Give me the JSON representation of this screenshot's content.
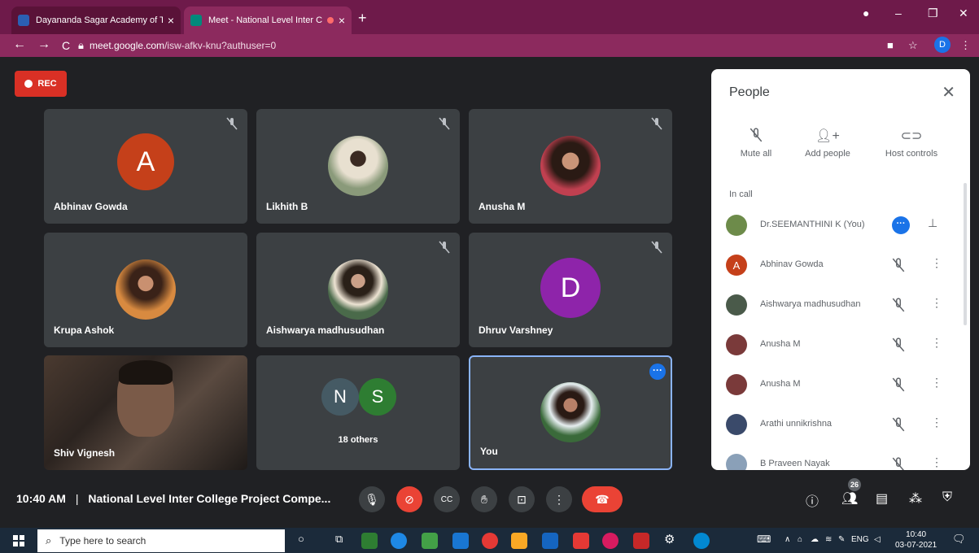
{
  "browser": {
    "tabs": [
      {
        "title": "Dayananda Sagar Academy of Te",
        "favicon_color": "#2b5fb3"
      },
      {
        "title": "Meet - National Level Inter C",
        "favicon_color": "#00897b"
      }
    ],
    "url_host": "meet.google.com",
    "url_path": "/isw-afkv-knu?authuser=0",
    "profile_initial": "D"
  },
  "rec_label": "REC",
  "tiles": [
    {
      "name": "Abhinav Gowda",
      "initial": "A",
      "avatar_color": "#c5401a",
      "muted": true
    },
    {
      "name": "Likhith B",
      "muted": true
    },
    {
      "name": "Anusha M",
      "muted": true
    },
    {
      "name": "Krupa Ashok",
      "muted": false
    },
    {
      "name": "Aishwarya madhusudhan",
      "muted": true
    },
    {
      "name": "Dhruv Varshney",
      "initial": "D",
      "avatar_color": "#8e24aa",
      "muted": true
    },
    {
      "name": "Shiv Vignesh",
      "muted": false
    },
    {
      "name": "18 others",
      "initials": [
        "N",
        "S"
      ],
      "colors": [
        "#455a64",
        "#2e7d32"
      ]
    },
    {
      "name": "You",
      "muted": false
    }
  ],
  "panel": {
    "title": "People",
    "actions": [
      "Mute all",
      "Add people",
      "Host controls"
    ],
    "section": "In call",
    "participants": [
      {
        "name": "Dr.SEEMANTHINI K (You)",
        "color": "#6d8b4a"
      },
      {
        "name": "Abhinav Gowda",
        "initial": "A",
        "color": "#c5401a"
      },
      {
        "name": "Aishwarya madhusudhan",
        "color": "#4a5a4a"
      },
      {
        "name": "Anusha M",
        "color": "#7a3a3a"
      },
      {
        "name": "Anusha M",
        "color": "#7a3a3a"
      },
      {
        "name": "Arathi unnikrishna",
        "color": "#3a4a6a"
      },
      {
        "name": "B Praveen Nayak",
        "color": "#8aa0b8"
      }
    ]
  },
  "footer": {
    "time": "10:40 AM",
    "meeting_title": "National Level Inter College Project Compe...",
    "participant_count": "26"
  },
  "taskbar": {
    "search_placeholder": "Type here to search",
    "lang": "ENG",
    "clock_time": "10:40",
    "clock_date": "03-07-2021"
  }
}
